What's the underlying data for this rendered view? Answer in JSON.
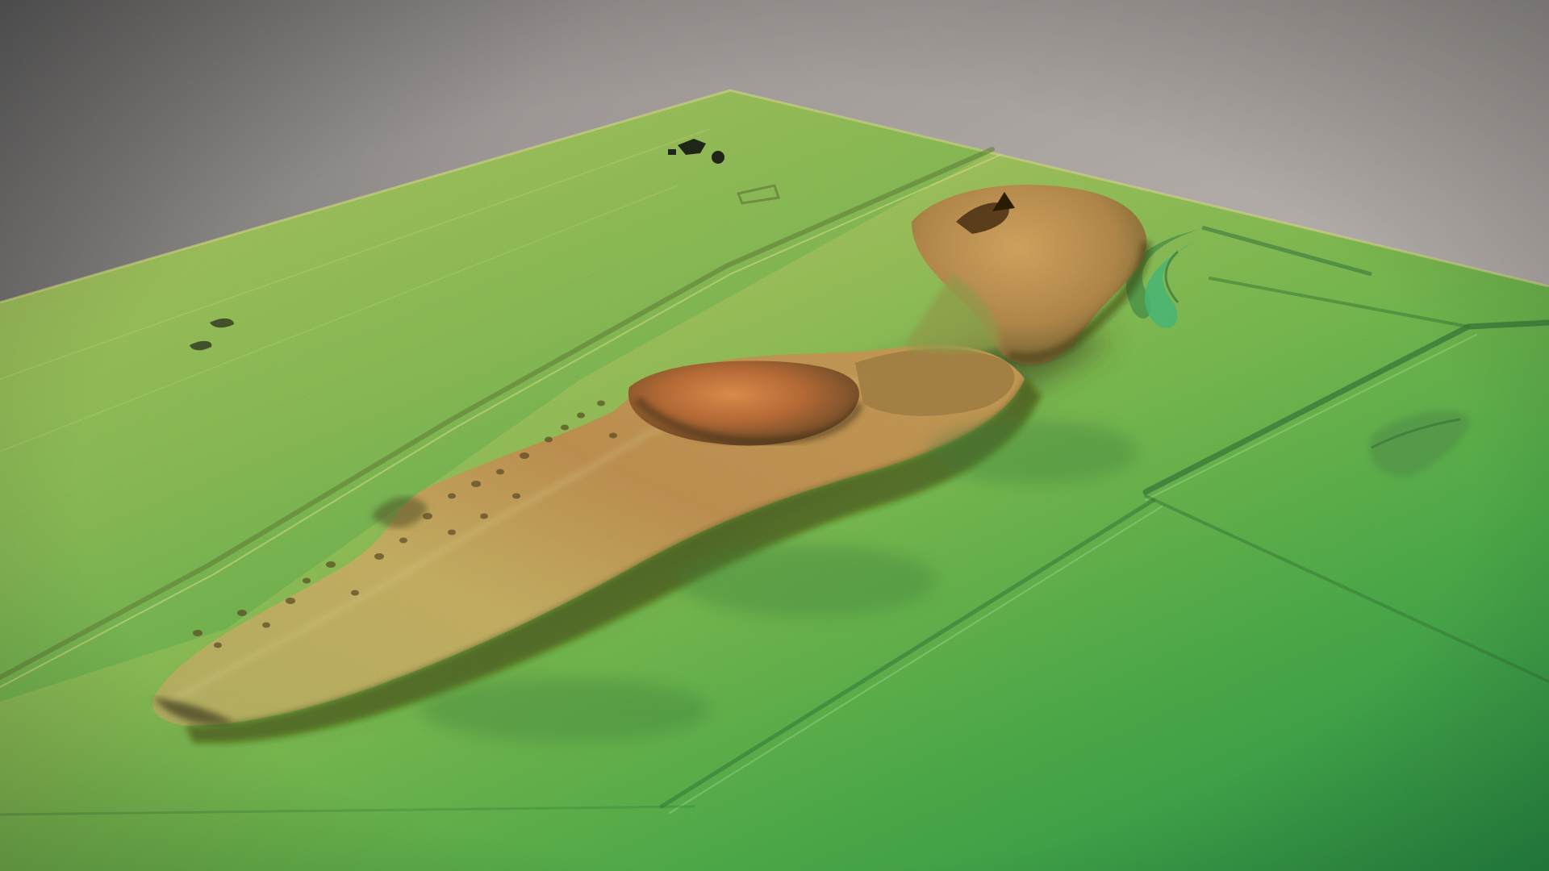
{
  "scene": {
    "type": "3D terrain elevation model (LiDAR-style hillshade)",
    "colors": {
      "sky_top": "#656565",
      "sky_mid": "#9f9a98",
      "sky_right": "#b0aaa6",
      "low_elevation": "#2e9a4c",
      "mid_low_elevation": "#6dbd4e",
      "mid_elevation": "#b5c865",
      "high_elevation": "#c9a35a",
      "peak_elevation": "#b76a37",
      "shadow": "#2c3a1a",
      "water_channel": "#3dab6a"
    },
    "features": [
      "terrain-surface",
      "central-ridge",
      "upper-hill",
      "lower-ridge-tail",
      "river-channel",
      "field-boundaries",
      "track-road",
      "small-structures",
      "pits-and-hollows"
    ]
  }
}
